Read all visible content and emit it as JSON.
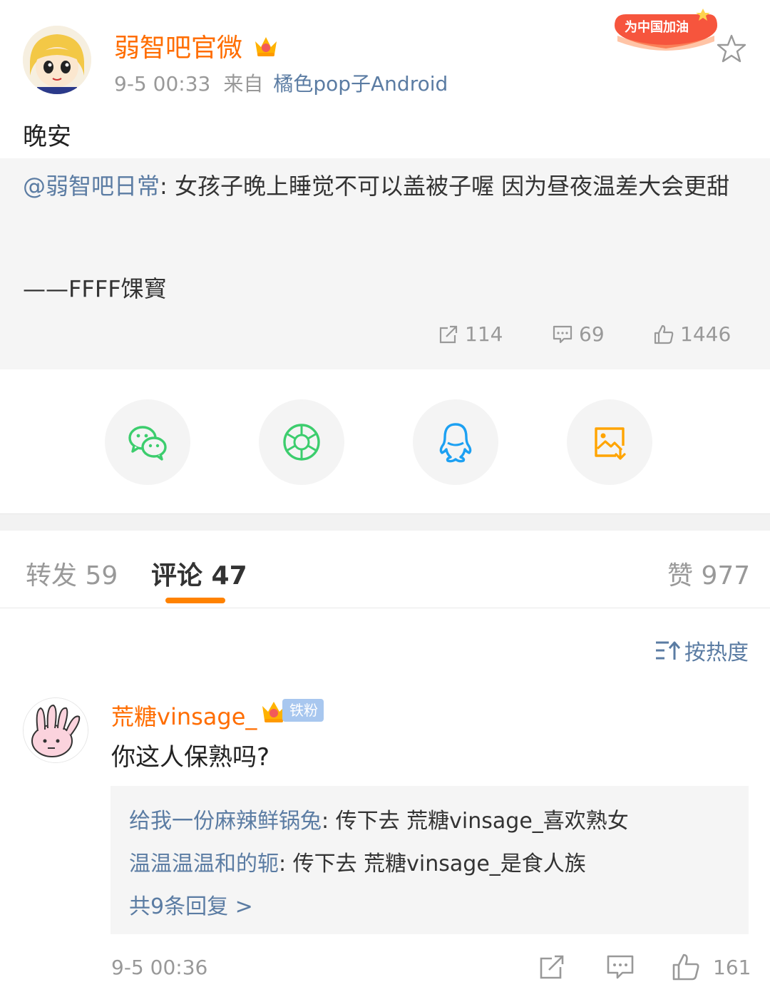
{
  "post": {
    "author": "弱智吧官微",
    "time": "9-5 00:33",
    "from_label": "来自",
    "source": "橘色pop子Android",
    "badge_text": "为中国加油",
    "text": "晚安"
  },
  "repost": {
    "mention": "@弱智吧日常",
    "text": ": 女孩子晚上睡觉不可以盖被子喔 因为昼夜温差大会更甜",
    "signature": "——FFFF馃寳",
    "shares": "114",
    "comments": "69",
    "likes": "1446"
  },
  "share_icons": [
    "wechat-icon",
    "moments-icon",
    "qq-icon",
    "save-image-icon"
  ],
  "tabs": {
    "repost_label": "转发 59",
    "comment_label": "评论 47",
    "like_label": "赞 977"
  },
  "sort_label": "按热度",
  "comment": {
    "name": "荒糖vinsage_",
    "fan_badge": "铁粉",
    "text": "你这人保熟吗?",
    "replies": [
      {
        "who": "给我一份麻辣鲜锅兔",
        "text": ": 传下去 荒糖vinsage_喜欢熟女"
      },
      {
        "who": "温温温温和的轭",
        "text": ": 传下去 荒糖vinsage_是食人族"
      }
    ],
    "more_replies": "共9条回复 >",
    "time": "9-5 00:36",
    "likes": "161"
  },
  "colors": {
    "accent": "#ff8200",
    "name_orange": "#ff6d00",
    "link_blue": "#5b7ca3",
    "gray_text": "#999999"
  }
}
